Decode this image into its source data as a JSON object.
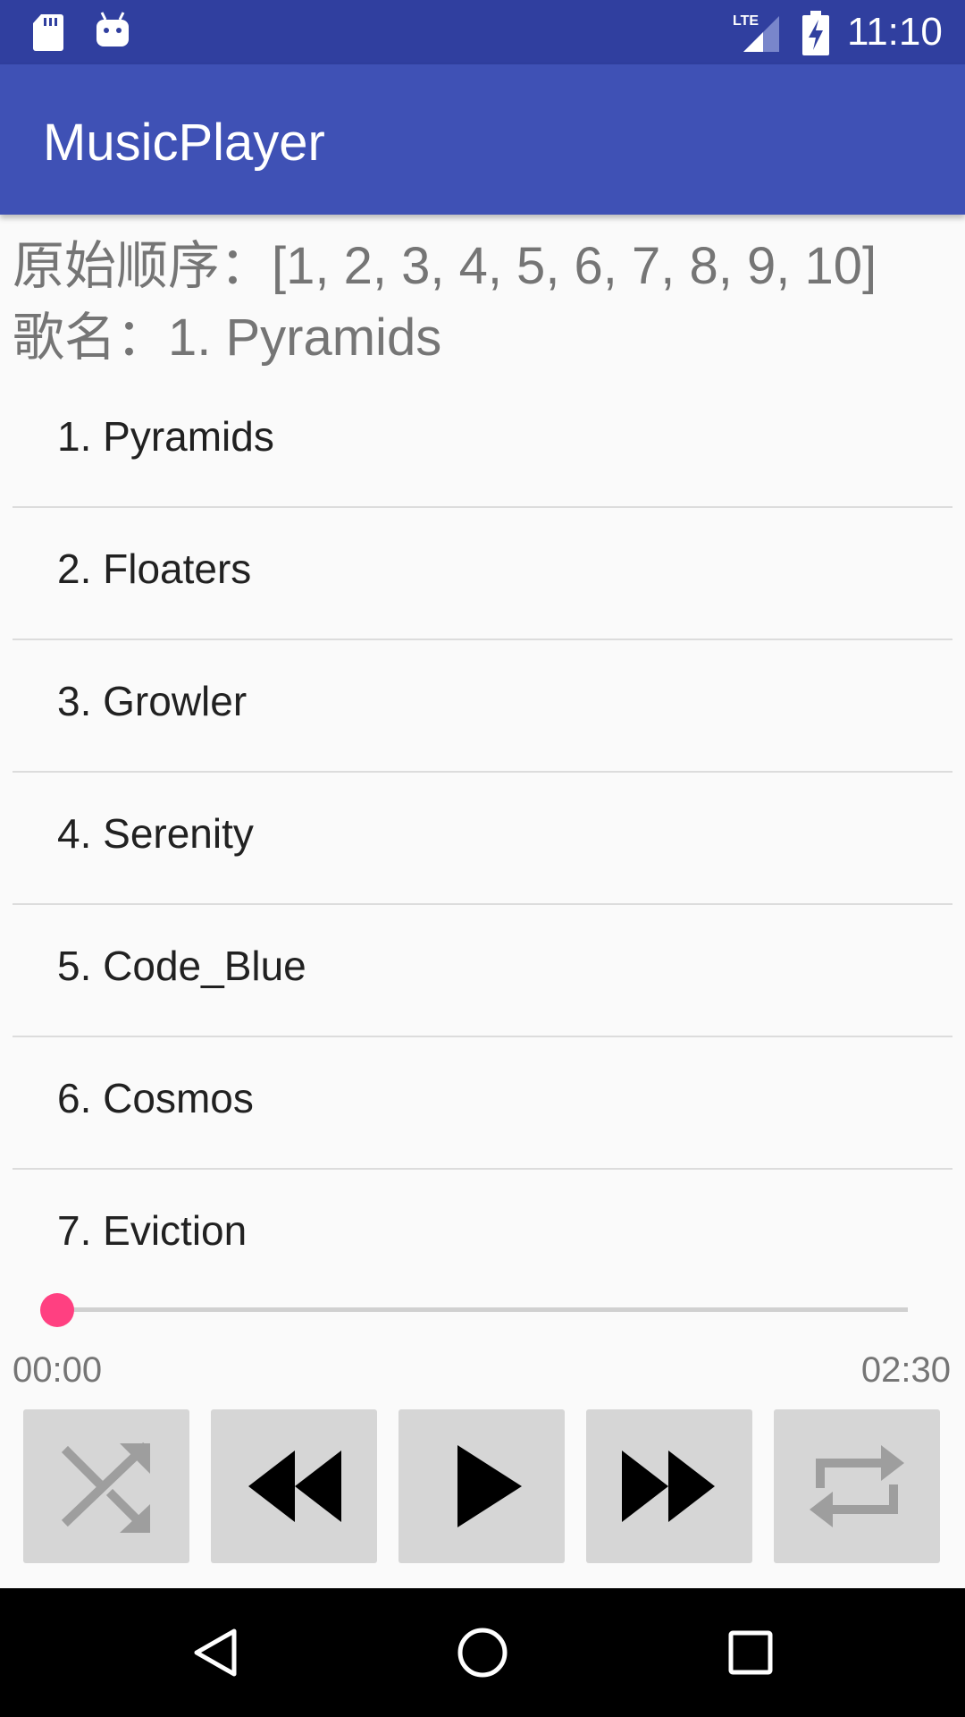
{
  "status_bar": {
    "time": "11:10",
    "icons": [
      "sd-card-icon",
      "android-icon",
      "lte-signal-icon",
      "battery-charging-icon"
    ]
  },
  "app_bar": {
    "title": "MusicPlayer"
  },
  "info": {
    "original_order": "原始顺序：[1, 2, 3, 4, 5, 6, 7, 8, 9, 10]",
    "song_name": "歌名：1. Pyramids"
  },
  "songs": [
    "1. Pyramids",
    "2. Floaters",
    "3. Growler",
    "4. Serenity",
    "5. Code_Blue",
    "6. Cosmos",
    "7. Eviction"
  ],
  "player": {
    "progress": 0,
    "current_time": "00:00",
    "total_time": "02:30",
    "accent_color": "#ff4081",
    "controls": [
      "shuffle-icon",
      "rewind-icon",
      "play-icon",
      "fast-forward-icon",
      "repeat-icon"
    ]
  },
  "colors": {
    "status_bar": "#303f9f",
    "app_bar": "#3f51b5"
  },
  "nav_bar": {
    "icons": [
      "back-icon",
      "home-icon",
      "recents-icon"
    ]
  }
}
